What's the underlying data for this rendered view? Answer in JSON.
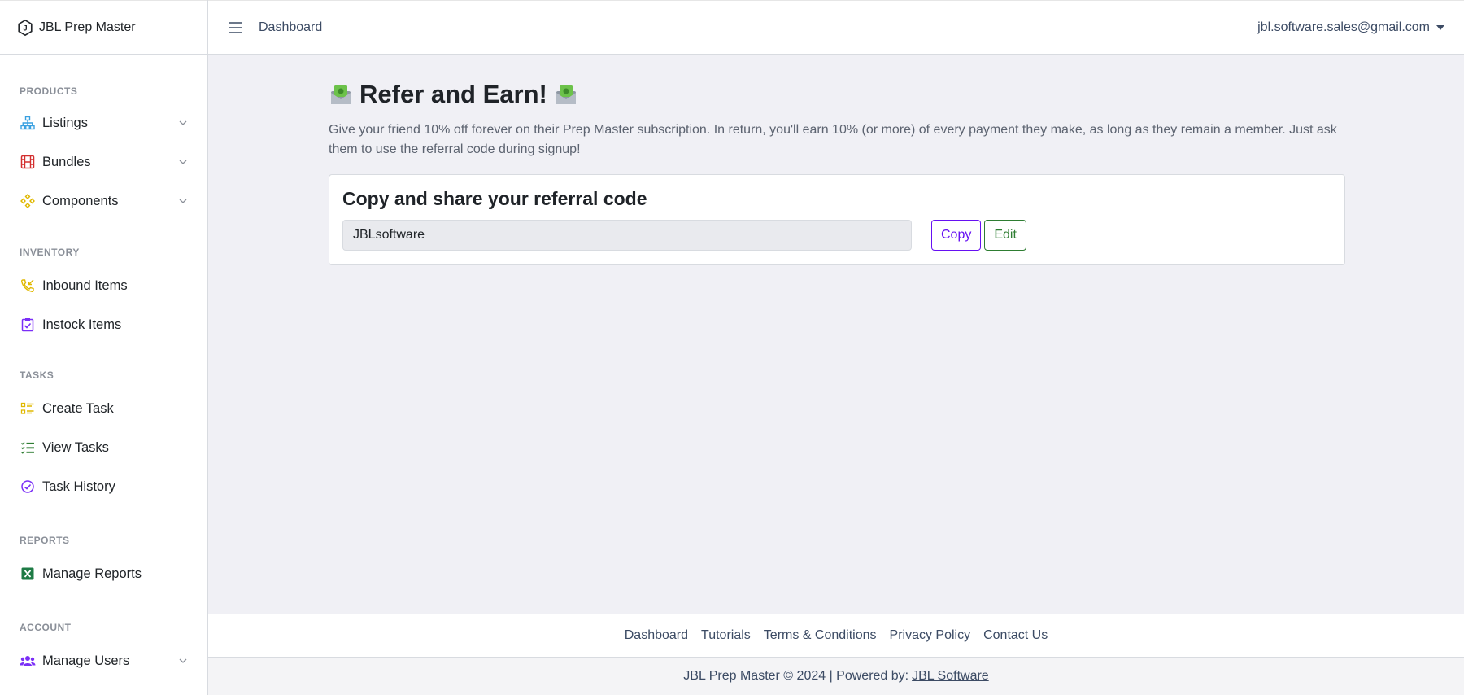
{
  "app": {
    "name": "JBL Prep Master"
  },
  "header": {
    "breadcrumb": "Dashboard",
    "user_email": "jbl.software.sales@gmail.com"
  },
  "sidebar": {
    "sections": [
      {
        "title": "PRODUCTS",
        "items": [
          {
            "label": "Listings",
            "icon": "sitemap-icon"
          },
          {
            "label": "Bundles",
            "icon": "film-grid-icon"
          },
          {
            "label": "Components",
            "icon": "components-icon"
          }
        ]
      },
      {
        "title": "INVENTORY",
        "items": [
          {
            "label": "Inbound Items",
            "icon": "phone-incoming-icon"
          },
          {
            "label": "Instock Items",
            "icon": "clipboard-check-icon"
          }
        ]
      },
      {
        "title": "TASKS",
        "items": [
          {
            "label": "Create Task",
            "icon": "list-icon"
          },
          {
            "label": "View Tasks",
            "icon": "checklist-icon"
          },
          {
            "label": "Task History",
            "icon": "check-circle-icon"
          }
        ]
      },
      {
        "title": "REPORTS",
        "items": [
          {
            "label": "Manage Reports",
            "icon": "excel-icon"
          }
        ]
      },
      {
        "title": "ACCOUNT",
        "items": [
          {
            "label": "Manage Users",
            "icon": "users-icon"
          }
        ]
      }
    ]
  },
  "main": {
    "title": "Refer and Earn!",
    "description": "Give your friend 10% off forever on their Prep Master subscription. In return, you'll earn 10% (or more) of every payment they make, as long as they remain a member. Just ask them to use the referral code during signup!",
    "card": {
      "title": "Copy and share your referral code",
      "code_value": "JBLsoftware",
      "copy_label": "Copy",
      "edit_label": "Edit"
    }
  },
  "footer": {
    "links": [
      "Dashboard",
      "Tutorials",
      "Terms & Conditions",
      "Privacy Policy",
      "Contact Us"
    ],
    "copyright": "JBL Prep Master © 2024 | Powered by:",
    "powered_by": "JBL Software"
  },
  "colors": {
    "accent_purple": "#6610f2",
    "accent_green": "#2e7d32",
    "background": "#f0f0f5"
  }
}
